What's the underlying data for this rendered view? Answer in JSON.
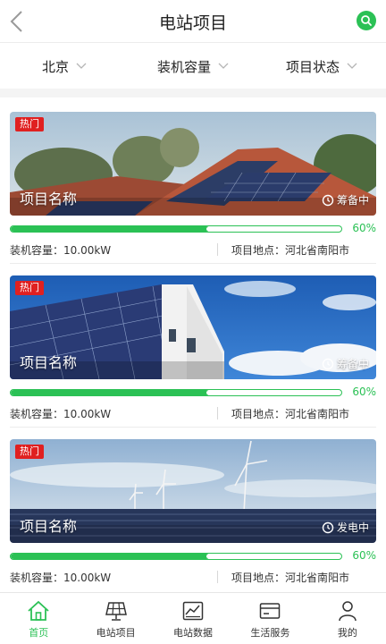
{
  "header": {
    "title": "电站项目"
  },
  "filters": [
    {
      "label": "北京"
    },
    {
      "label": "装机容量"
    },
    {
      "label": "项目状态"
    }
  ],
  "cards": [
    {
      "badge": "热门",
      "name": "项目名称",
      "status": "筹备中",
      "progress": 60,
      "progress_text": "60%",
      "capacity": "装机容量：10.00kW",
      "location": "项目地点：河北省南阳市"
    },
    {
      "badge": "热门",
      "name": "项目名称",
      "status": "筹备中",
      "progress": 60,
      "progress_text": "60%",
      "capacity": "装机容量：10.00kW",
      "location": "项目地点：河北省南阳市"
    },
    {
      "badge": "热门",
      "name": "项目名称",
      "status": "发电中",
      "progress": 60,
      "progress_text": "60%",
      "capacity": "装机容量：10.00kW",
      "location": "项目地点：河北省南阳市"
    }
  ],
  "tabbar": [
    {
      "label": "首页",
      "icon": "home-icon",
      "active": true
    },
    {
      "label": "电站项目",
      "icon": "solar-panel-icon",
      "active": false
    },
    {
      "label": "电站数据",
      "icon": "chart-icon",
      "active": false
    },
    {
      "label": "生活服务",
      "icon": "card-icon",
      "active": false
    },
    {
      "label": "我的",
      "icon": "user-icon",
      "active": false
    }
  ],
  "colors": {
    "accent": "#2bc155",
    "hot_badge": "#e02020"
  }
}
